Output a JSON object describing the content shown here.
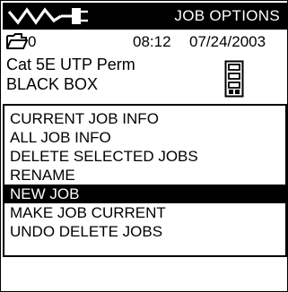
{
  "header": {
    "title": "JOB OPTIONS",
    "logo_icon": "cable-tester-logo-icon"
  },
  "status": {
    "folder_icon": "folder-icon",
    "folder_count": "0",
    "time": "08:12",
    "date": "07/24/2003"
  },
  "job": {
    "cable_type": "Cat 5E UTP Perm",
    "name": "BLACK BOX",
    "remote_icon": "remote-unit-icon"
  },
  "menu": {
    "selected_index": 4,
    "items": [
      {
        "label": "CURRENT JOB INFO"
      },
      {
        "label": "ALL JOB INFO"
      },
      {
        "label": "DELETE SELECTED JOBS"
      },
      {
        "label": "RENAME"
      },
      {
        "label": "NEW JOB"
      },
      {
        "label": "MAKE JOB CURRENT"
      },
      {
        "label": "UNDO DELETE JOBS"
      }
    ]
  },
  "colors": {
    "foreground": "#000000",
    "background": "#ffffff",
    "highlight": "#000000"
  }
}
